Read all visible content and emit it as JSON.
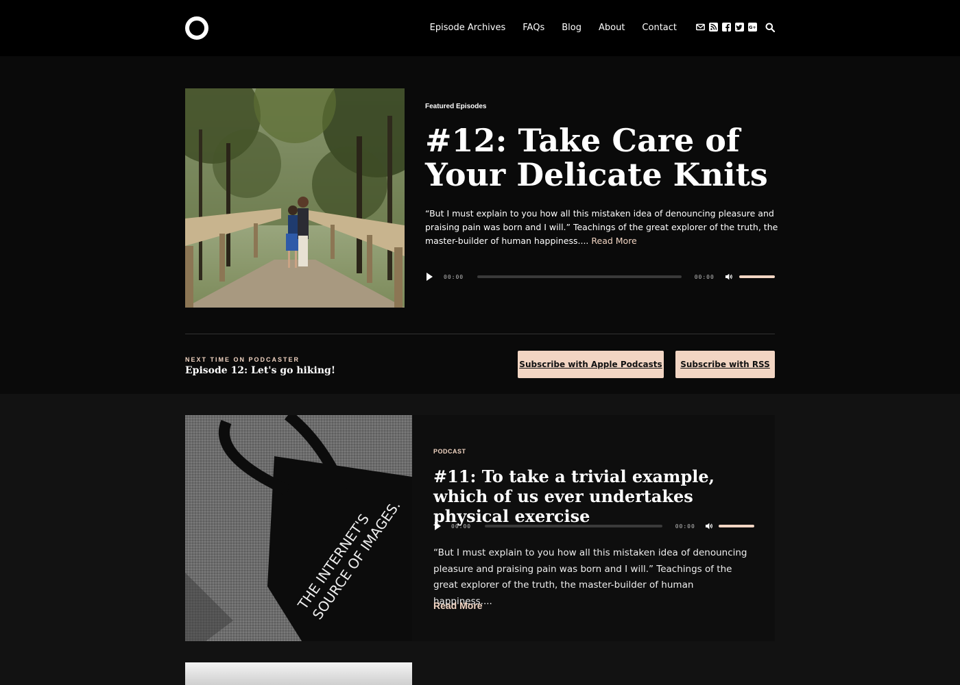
{
  "header": {
    "nav": [
      "Episode Archives",
      "FAQs",
      "Blog",
      "About",
      "Contact"
    ],
    "social_icons": [
      "mail-icon",
      "rss-icon",
      "facebook-icon",
      "twitter-icon",
      "google-plus-icon"
    ],
    "search_icon": "search-icon"
  },
  "featured": {
    "kicker": "Featured Episodes",
    "title": "#12: Take Care of Your Delicate Knits",
    "excerpt": "“But I must explain to you how all this mistaken idea of denouncing pleasure and praising pain was born and I will.” Teachings of the great explorer of the truth, the master-builder of human happiness....",
    "read_more": "Read More",
    "player": {
      "current": "00:00",
      "duration": "00:00",
      "volume": 1.0
    }
  },
  "next": {
    "label": "NEXT TIME ON PODCASTER",
    "title": "Episode 12: Let's go hiking!"
  },
  "subscribe": {
    "apple": "Subscribe with Apple Podcasts",
    "rss": "Subscribe with RSS"
  },
  "post": {
    "kicker": "PODCAST",
    "title": "#11: To take a trivial example, which of us ever undertakes physical exercise",
    "excerpt": "“But I must explain to you how all this mistaken idea of denouncing pleasure and praising pain was born and I will.” Teachings of the great explorer of the truth, the master-builder of human happiness....",
    "read_more": "Read More",
    "player": {
      "current": "00:00",
      "duration": "00:00",
      "volume": 1.0
    },
    "image_text": [
      "THE INTERNET'S",
      "SOURCE OF IMAGES."
    ]
  },
  "colors": {
    "accent": "#f2d5c3",
    "bg": "#121212",
    "header": "#000000"
  }
}
